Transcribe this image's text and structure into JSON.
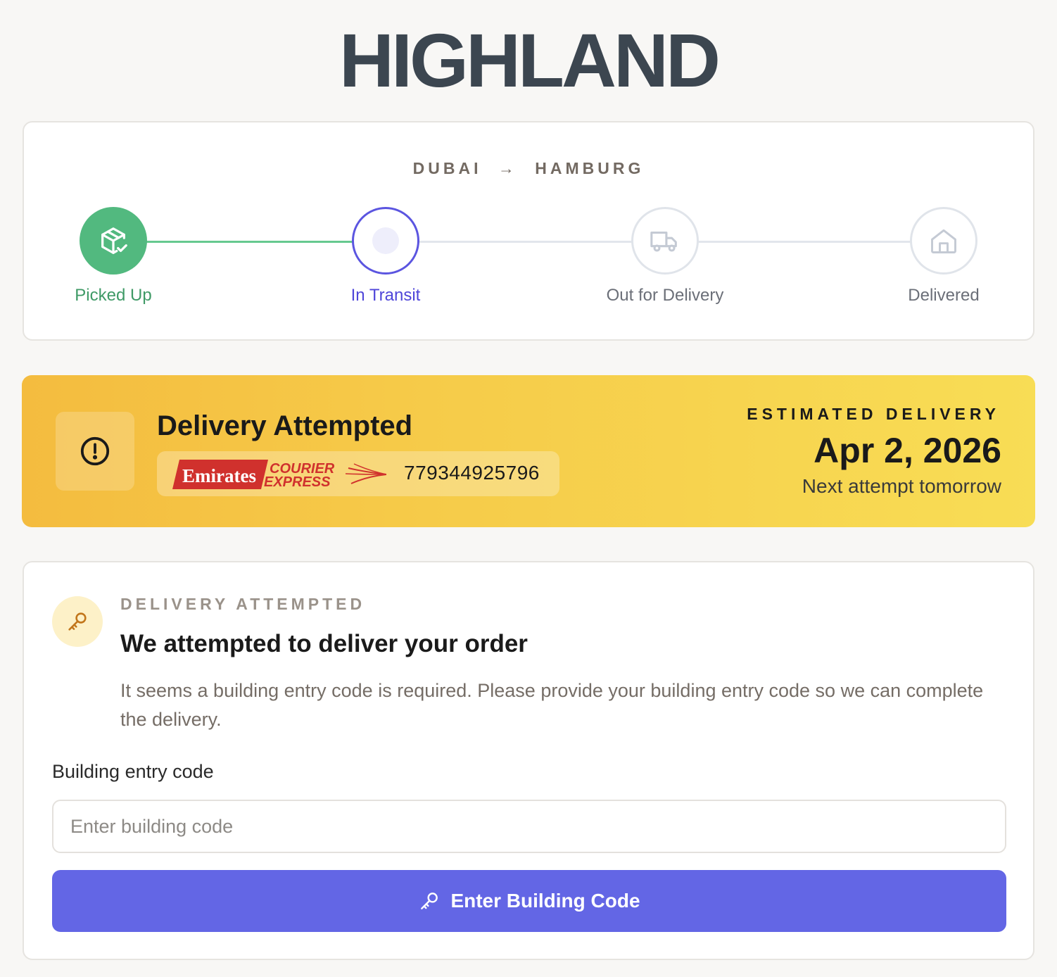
{
  "brand": {
    "name": "HIGHLAND"
  },
  "route": {
    "origin": "DUBAI",
    "arrow": "→",
    "destination": "HAMBURG"
  },
  "progress": {
    "steps": [
      {
        "label": "Picked Up",
        "state": "complete",
        "icon": "package-check-icon"
      },
      {
        "label": "In Transit",
        "state": "current",
        "icon": "dot-icon"
      },
      {
        "label": "Out for Delivery",
        "state": "pending",
        "icon": "truck-icon"
      },
      {
        "label": "Delivered",
        "state": "pending",
        "icon": "home-icon"
      }
    ],
    "colors": {
      "complete": "#52b97f",
      "current": "#5b55e0",
      "pending": "#e0e4ea"
    }
  },
  "status_banner": {
    "icon": "alert-circle-icon",
    "title": "Delivery Attempted",
    "carrier": {
      "logo_text_primary": "Emirates",
      "logo_text_secondary_1": "COURIER",
      "logo_text_secondary_2": "EXPRESS"
    },
    "tracking_number": "779344925796",
    "estimated_label": "ESTIMATED DELIVERY",
    "estimated_date": "Apr 2, 2026",
    "estimated_note": "Next attempt tomorrow",
    "colors": {
      "gradient_start": "#f4bc3f",
      "gradient_end": "#f8dd55"
    }
  },
  "action": {
    "icon": "key-icon",
    "eyebrow": "DELIVERY ATTEMPTED",
    "headline": "We attempted to deliver your order",
    "body": "It seems a building entry code is required. Please provide your building entry code so we can complete the delivery.",
    "field_label": "Building entry code",
    "input_value": "",
    "input_placeholder": "Enter building code",
    "button_label": "Enter Building Code",
    "button_icon": "key-icon",
    "colors": {
      "button": "#6366e5"
    }
  }
}
